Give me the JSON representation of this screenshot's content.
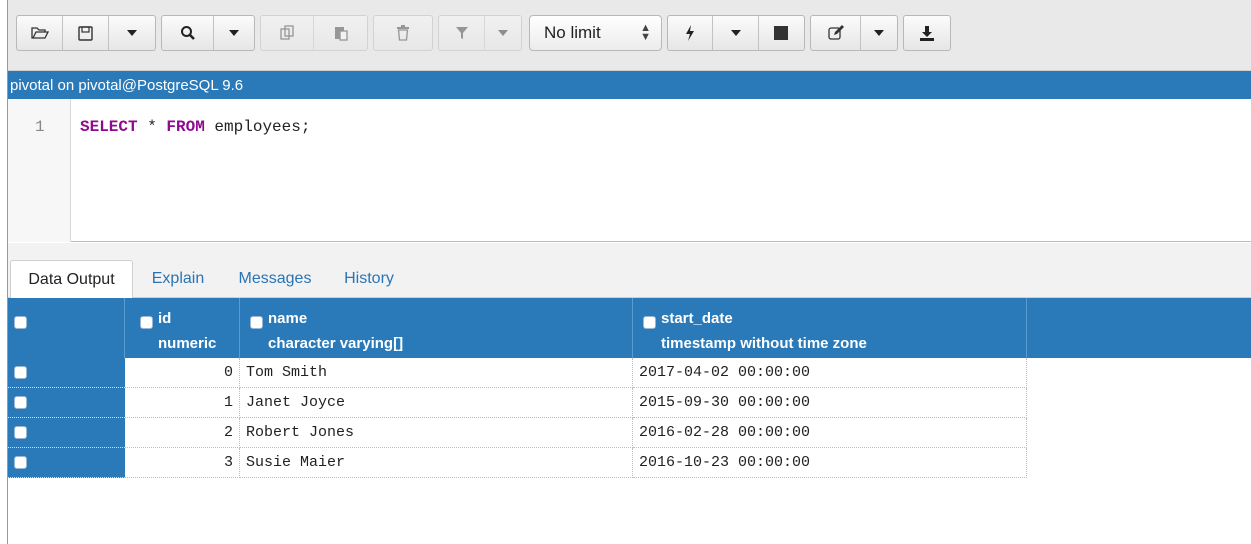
{
  "toolbar": {
    "icons": [
      "open-folder-icon",
      "save-icon",
      "find-icon",
      "copy-icon",
      "paste-icon",
      "delete-icon",
      "filter-icon",
      "execute-icon",
      "stop-icon",
      "edit-icon",
      "download-icon"
    ],
    "limit_value": "No limit"
  },
  "connection": {
    "label": "pivotal on pivotal@PostgreSQL 9.6"
  },
  "editor": {
    "line_number": "1",
    "sql_keyword1": "SELECT",
    "sql_middle": " * ",
    "sql_keyword2": "FROM",
    "sql_rest": " employees;"
  },
  "tabs": [
    {
      "label": "Data Output",
      "active": true
    },
    {
      "label": "Explain",
      "active": false
    },
    {
      "label": "Messages",
      "active": false
    },
    {
      "label": "History",
      "active": false
    }
  ],
  "grid": {
    "columns": [
      {
        "name": "id",
        "type": "numeric"
      },
      {
        "name": "name",
        "type": "character varying[]"
      },
      {
        "name": "start_date",
        "type": "timestamp without time zone"
      }
    ],
    "rows": [
      {
        "id": "0",
        "name": "Tom Smith",
        "start_date": "2017-04-02 00:00:00"
      },
      {
        "id": "1",
        "name": "Janet Joyce",
        "start_date": "2015-09-30 00:00:00"
      },
      {
        "id": "2",
        "name": "Robert Jones",
        "start_date": "2016-02-28 00:00:00"
      },
      {
        "id": "3",
        "name": "Susie Maier",
        "start_date": "2016-10-23 00:00:00"
      }
    ]
  },
  "colors": {
    "accent": "#2a7ab9",
    "keyword": "#8e0a8e"
  }
}
